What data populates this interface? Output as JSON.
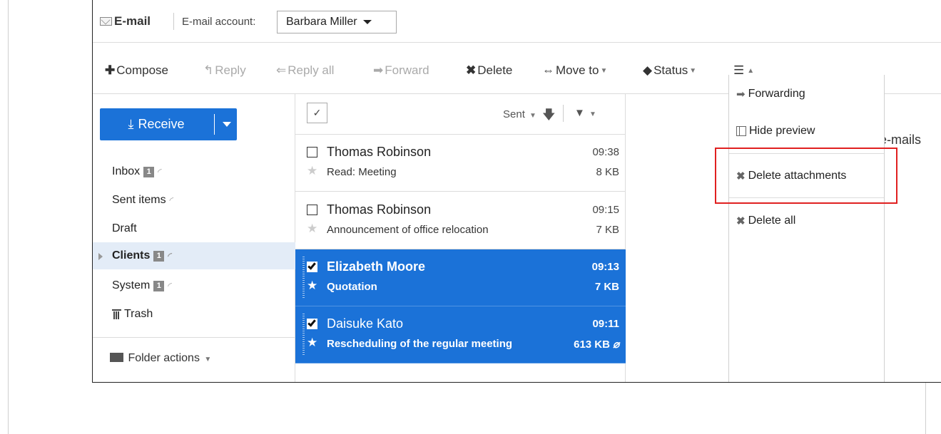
{
  "header": {
    "app_title": "E-mail",
    "account_label": "E-mail account:",
    "account_value": "Barbara Miller"
  },
  "toolbar": {
    "compose": "Compose",
    "reply": "Reply",
    "reply_all": "Reply all",
    "forward": "Forward",
    "delete": "Delete",
    "move_to": "Move to",
    "status": "Status"
  },
  "sidebar": {
    "receive_label": "Receive",
    "folders": [
      {
        "label": "Inbox",
        "badge": "1"
      },
      {
        "label": "Sent items"
      },
      {
        "label": "Draft"
      },
      {
        "label": "Clients",
        "badge": "1"
      },
      {
        "label": "System",
        "badge": "1"
      },
      {
        "label": "Trash"
      }
    ],
    "folder_actions": "Folder actions"
  },
  "list": {
    "sort_label": "Sent",
    "rows": [
      {
        "sender": "Thomas Robinson",
        "time": "09:38",
        "subject": "Read: Meeting",
        "size": "8 KB"
      },
      {
        "sender": "Thomas Robinson",
        "time": "09:15",
        "subject": "Announcement of office relocation",
        "size": "7 KB"
      },
      {
        "sender": "Elizabeth Moore",
        "time": "09:13",
        "subject": "Quotation",
        "size": "7 KB"
      },
      {
        "sender": "Daisuke Kato",
        "time": "09:11",
        "subject": "Rescheduling of the regular meeting",
        "size": "613 KB"
      }
    ]
  },
  "preview": {
    "partial_text": "e-mails"
  },
  "menu": {
    "items": [
      "Forwarding",
      "Hide preview",
      "Delete attachments",
      "Delete all"
    ]
  },
  "colors": {
    "accent": "#1b72d8",
    "highlight": "#e02020"
  }
}
